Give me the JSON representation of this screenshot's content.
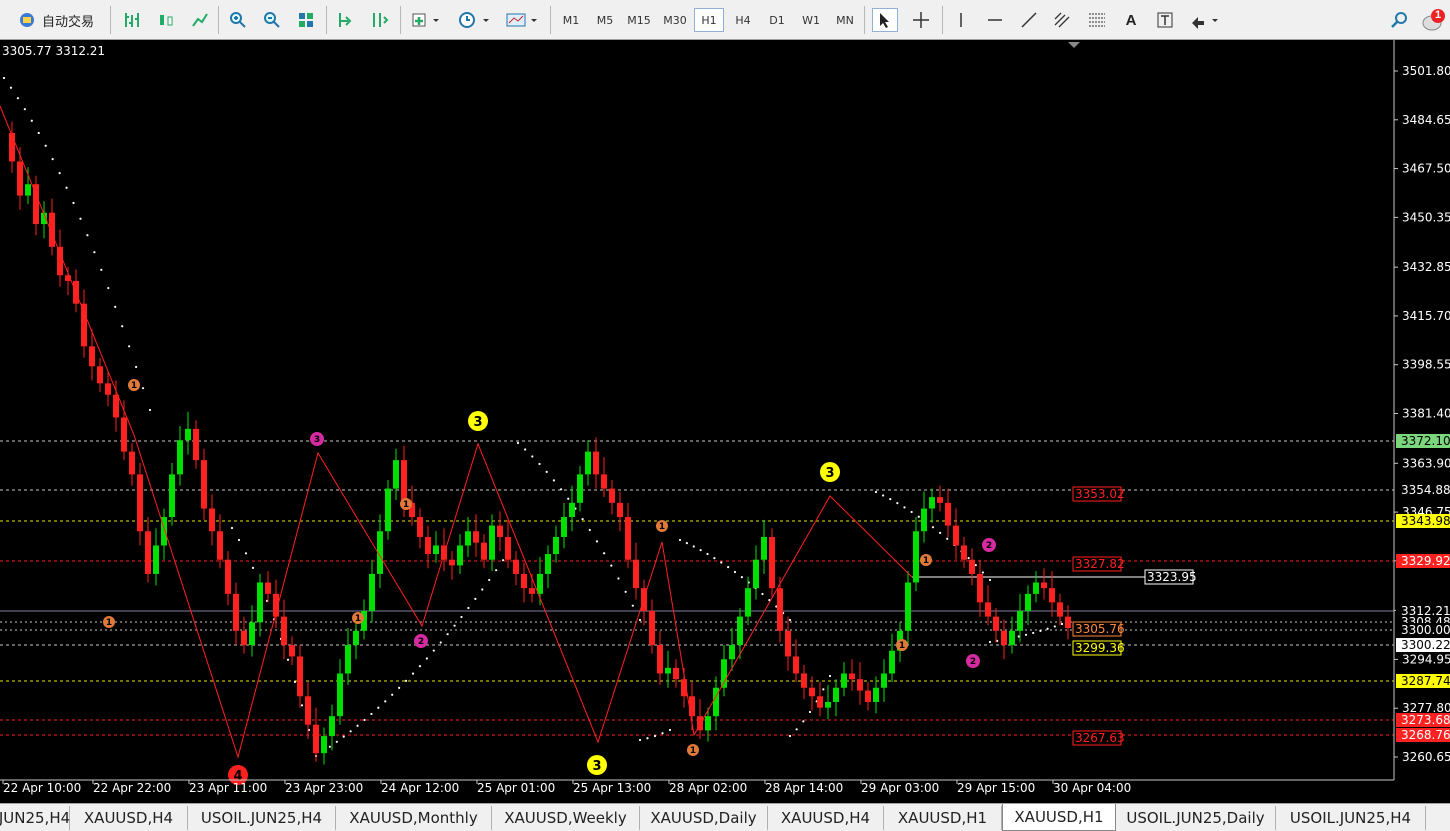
{
  "toolbar": {
    "auto_trade_label": "自动交易",
    "timeframes": [
      "M1",
      "M5",
      "M15",
      "M30",
      "H1",
      "H4",
      "D1",
      "W1",
      "MN"
    ],
    "active_timeframe": "H1",
    "notification_count": "1"
  },
  "chart": {
    "ohlc_header": "3305.77 3312.21",
    "colors": {
      "bull": "#00e000",
      "bear": "#ff2020",
      "zigzag": "#ff2020",
      "sar": "#ffffff"
    },
    "price_axis": [
      "3501.80",
      "3484.65",
      "3467.50",
      "3450.35",
      "3432.85",
      "3415.70",
      "3398.55",
      "3381.40",
      "3363.90",
      "3346.75",
      "3329.60",
      "3312.21",
      "3294.95",
      "3277.80",
      "3260.65"
    ],
    "time_axis": [
      "22 Apr 10:00",
      "22 Apr 22:00",
      "23 Apr 11:00",
      "23 Apr 23:00",
      "24 Apr 12:00",
      "25 Apr 01:00",
      "25 Apr 13:00",
      "28 Apr 02:00",
      "28 Apr 14:00",
      "29 Apr 03:00",
      "29 Apr 15:00",
      "30 Apr 04:00"
    ],
    "level_labels": {
      "l3372": "3372.10",
      "l3354": "3354.88",
      "l3343": "3343.98",
      "l3329": "3329.92",
      "l3312": "3312.21",
      "l3308": "3308.48",
      "l3300a": "3300.00",
      "l3300b": "3300.22",
      "l3287": "3287.74",
      "l3273": "3273.68",
      "l3268": "3268.76"
    },
    "inline_labels": {
      "il3353": "3353.02",
      "il3327": "3327.82",
      "il3323": "3323.95",
      "il3305": "3305.76",
      "il3299": "3299.36",
      "il3267": "3267.63"
    },
    "wave_markers": {
      "m1": "1",
      "m2": "3",
      "m3": "1",
      "m4": "1",
      "m5": "2",
      "m6": "3",
      "m7": "1",
      "m8": "3",
      "m9": "1",
      "m10": "3",
      "m11": "1",
      "m12": "2",
      "m13": "1",
      "m14": "2",
      "m15": "1",
      "m16": "4"
    }
  },
  "tabs": [
    "JUN25,H4",
    "XAUUSD,H4",
    "USOIL.JUN25,H4",
    "XAUUSD,Monthly",
    "XAUUSD,Weekly",
    "XAUUSD,Daily",
    "XAUUSD,H4",
    "XAUUSD,H1",
    "XAUUSD,H1",
    "USOIL.JUN25,Daily",
    "USOIL.JUN25,H4"
  ],
  "active_tab": "XAUUSD,H1"
}
